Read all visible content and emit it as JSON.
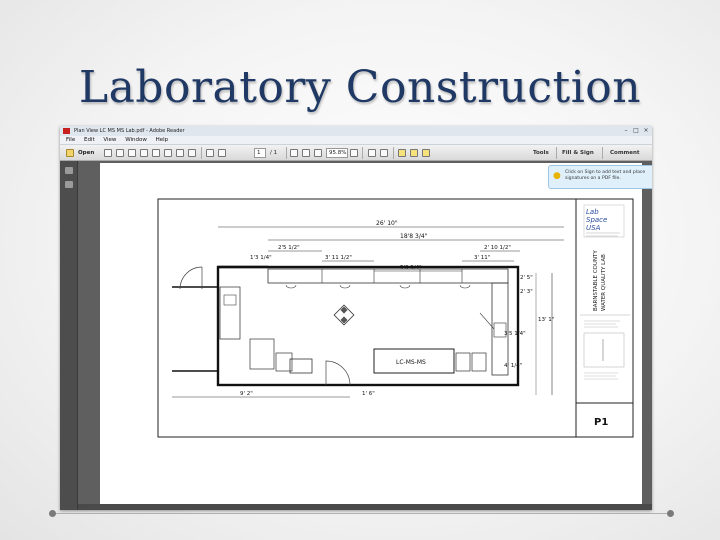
{
  "slide": {
    "title": "Laboratory Construction"
  },
  "reader": {
    "window_title": "Plan View LC MS MS Lab.pdf - Adobe Reader",
    "menu": [
      "File",
      "Edit",
      "View",
      "Window",
      "Help"
    ],
    "toolbar": {
      "open_label": "Open",
      "page_current": "1",
      "page_total": "/ 1",
      "zoom": "95.8%",
      "tools_label": "Tools",
      "fill_sign_label": "Fill & Sign",
      "comment_label": "Comment"
    },
    "tooltip": "Click on Sign to add text and place signatures on a PDF file."
  },
  "drawing": {
    "dims": {
      "overall": "26' 10\"",
      "d18_8": "18'8 3/4\"",
      "d2_5": "2'5 1/2\"",
      "d1_3": "1'3 1/4\"",
      "d3_11a": "3' 11 1/2\"",
      "d5_8": "5'8 3/4\"",
      "d3_11b": "3' 11\"",
      "d2_10": "2' 10 1/2\"",
      "d2_5b": "2' 5\"",
      "d2_3": "2' 3\"",
      "d13_1": "13' 1\"",
      "d3_5": "3'5 1/4\"",
      "d4_1": "4' 1/4\"",
      "d9_2": "9' 2\"",
      "d1_6": "1' 6\""
    },
    "bench_label": "LC-MS-MS",
    "titleblock": {
      "logo_line1": "Lab",
      "logo_line2": "Space",
      "logo_line3": "USA",
      "client_line1": "BARNSTABLE COUNTY",
      "client_line2": "WATER QUALITY LAB",
      "sheet": "P1"
    }
  }
}
